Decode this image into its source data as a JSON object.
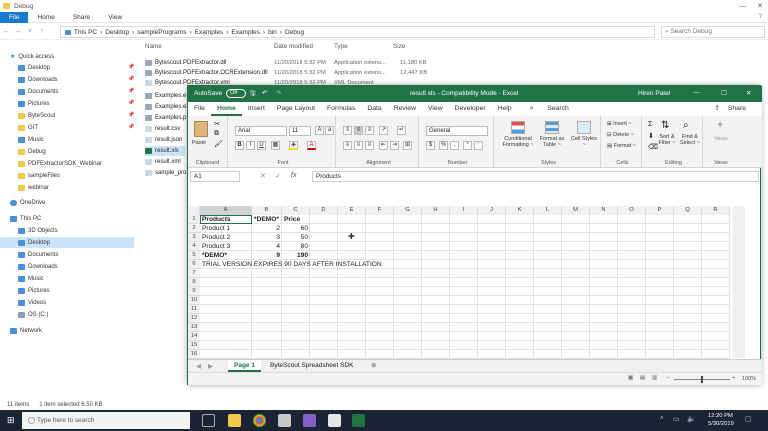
{
  "explorer": {
    "title": "Debug",
    "ribbon_tabs": [
      "File",
      "Home",
      "Share",
      "View"
    ],
    "breadcrumb": [
      "This PC",
      "Desktop",
      "samplePrograms",
      "Examples",
      "Examples",
      "bin",
      "Debug"
    ],
    "search_placeholder": "Search Debug",
    "quick_access_label": "Quick access",
    "nav_quick": [
      "Desktop",
      "Downloads",
      "Documents",
      "Pictures",
      "ByteScout",
      "GIT",
      "Music",
      "Debug",
      "PDFExtractorSDK_Webinar",
      "sampleFiles",
      "webinar"
    ],
    "onedrive_label": "OneDrive",
    "thispc_label": "This PC",
    "nav_pc": [
      "3D Objects",
      "Desktop",
      "Documents",
      "Downloads",
      "Music",
      "Pictures",
      "Videos",
      "OS (C:)"
    ],
    "network_label": "Network",
    "columns": {
      "name": "Name",
      "date": "Date modified",
      "type": "Type",
      "size": "Size"
    },
    "files": [
      {
        "name": "Bytescout.PDFExtractor.dll",
        "date": "11/20/2018 5:32 PM",
        "type": "Application extens...",
        "size": "11,180 KB"
      },
      {
        "name": "Bytescout.PDFExtractor.OCRExtension.dll",
        "date": "11/20/2018 5:32 PM",
        "type": "Application extens...",
        "size": "12,447 KB"
      },
      {
        "name": "Bytescout.PDFExtractor.xml",
        "date": "11/20/2018 5:32 PM",
        "type": "XML Document",
        "size": ""
      },
      {
        "name": "Examples.e",
        "date": "",
        "type": "",
        "size": ""
      },
      {
        "name": "Examples.e",
        "date": "",
        "type": "",
        "size": ""
      },
      {
        "name": "Examples.p",
        "date": "",
        "type": "",
        "size": ""
      },
      {
        "name": "result.csv",
        "date": "",
        "type": "",
        "size": ""
      },
      {
        "name": "result.json",
        "date": "",
        "type": "",
        "size": ""
      },
      {
        "name": "result.xls",
        "date": "",
        "type": "",
        "size": ""
      },
      {
        "name": "result.xml",
        "date": "",
        "type": "",
        "size": ""
      },
      {
        "name": "sample_pro",
        "date": "",
        "type": "",
        "size": ""
      }
    ],
    "status_items": "11 items",
    "status_selected": "1 item selected  6.50 KB"
  },
  "excel": {
    "autosave_label": "AutoSave",
    "autosave_state": "Off",
    "window_title": "result.xls  -  Compatibility Mode  -  Excel",
    "user": "Hiren Patel",
    "menu": [
      "File",
      "Home",
      "Insert",
      "Page Layout",
      "Formulas",
      "Data",
      "Review",
      "View",
      "Developer",
      "Help"
    ],
    "search_label": "Search",
    "share_label": "Share",
    "ribbon": {
      "clipboard": "Clipboard",
      "paste": "Paste",
      "font_name": "Arial",
      "font_size": "11",
      "font": "Font",
      "alignment": "Alignment",
      "number_format": "General",
      "number": "Number",
      "conditional": "Conditional Formatting ~",
      "format_table": "Format as Table ~",
      "cell_styles": "Cell Styles ~",
      "styles": "Styles",
      "insert": "Insert ~",
      "delete": "Delete ~",
      "format": "Format ~",
      "cells": "Cells",
      "sort_filter": "Sort & Filter ~",
      "find_select": "Find & Select ~",
      "editing": "Editing",
      "ideas_btn": "Ideas",
      "ideas": "Ideas"
    },
    "name_box": "A1",
    "formula": "Products",
    "columns": [
      "A",
      "B",
      "C",
      "D",
      "E",
      "F",
      "G",
      "H",
      "I",
      "J",
      "K",
      "L",
      "M",
      "N",
      "O",
      "P",
      "Q",
      "R"
    ],
    "rows": [
      "1",
      "2",
      "3",
      "4",
      "5",
      "6",
      "7",
      "8",
      "9",
      "10",
      "11",
      "12",
      "13",
      "14",
      "15",
      "16"
    ],
    "cells": [
      {
        "r": 0,
        "c": 0,
        "v": "Products",
        "bold": true
      },
      {
        "r": 0,
        "c": 1,
        "v": "*DEMO*",
        "bold": true
      },
      {
        "r": 0,
        "c": 2,
        "v": "Price",
        "bold": true
      },
      {
        "r": 1,
        "c": 0,
        "v": "Product 1"
      },
      {
        "r": 1,
        "c": 1,
        "v": "2",
        "right": true
      },
      {
        "r": 1,
        "c": 2,
        "v": "60",
        "right": true
      },
      {
        "r": 2,
        "c": 0,
        "v": "Product 2"
      },
      {
        "r": 2,
        "c": 1,
        "v": "3",
        "right": true
      },
      {
        "r": 2,
        "c": 2,
        "v": "50",
        "right": true
      },
      {
        "r": 3,
        "c": 0,
        "v": "Product 3"
      },
      {
        "r": 3,
        "c": 1,
        "v": "4",
        "right": true
      },
      {
        "r": 3,
        "c": 2,
        "v": "80",
        "right": true
      },
      {
        "r": 4,
        "c": 0,
        "v": "*DEMO*",
        "bold": true
      },
      {
        "r": 4,
        "c": 1,
        "v": "9",
        "right": true,
        "bold": true
      },
      {
        "r": 4,
        "c": 2,
        "v": "190",
        "right": true,
        "bold": true
      },
      {
        "r": 5,
        "c": 0,
        "v": "TRIAL VERSION EXPIRES 90 DAYS AFTER INSTALLATION"
      }
    ],
    "sheets": [
      "Page 1",
      "ByteScout Spreadsheet SDK"
    ],
    "zoom": "100%"
  },
  "taskbar": {
    "search_placeholder": "Type here to search",
    "time": "12:20 PM",
    "date": "5/30/2019"
  },
  "colors": {
    "excel_green": "#217346",
    "taskbar": "#1c2433",
    "explorer_accent": "#1979ca"
  }
}
